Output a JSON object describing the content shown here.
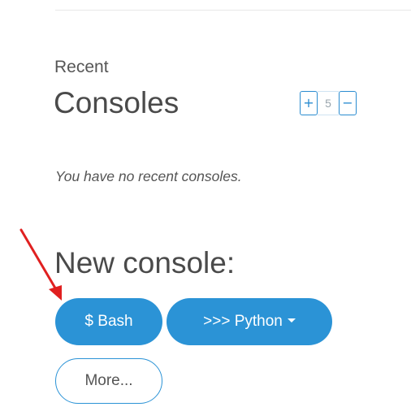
{
  "recent": {
    "subtitle": "Recent",
    "title": "Consoles",
    "stepper": {
      "plus_label": "+",
      "value": "5",
      "minus_label": "−"
    },
    "empty_message": "You have no recent consoles."
  },
  "new_console": {
    "title": "New console:",
    "bash_label": "$ Bash",
    "python_label": ">>> Python",
    "more_label": "More..."
  },
  "colors": {
    "accent": "#2b93d6",
    "annotation_arrow": "#e02020"
  },
  "icons": {
    "dropdown": "caret-down-icon",
    "annotation": "red-arrow-icon"
  }
}
